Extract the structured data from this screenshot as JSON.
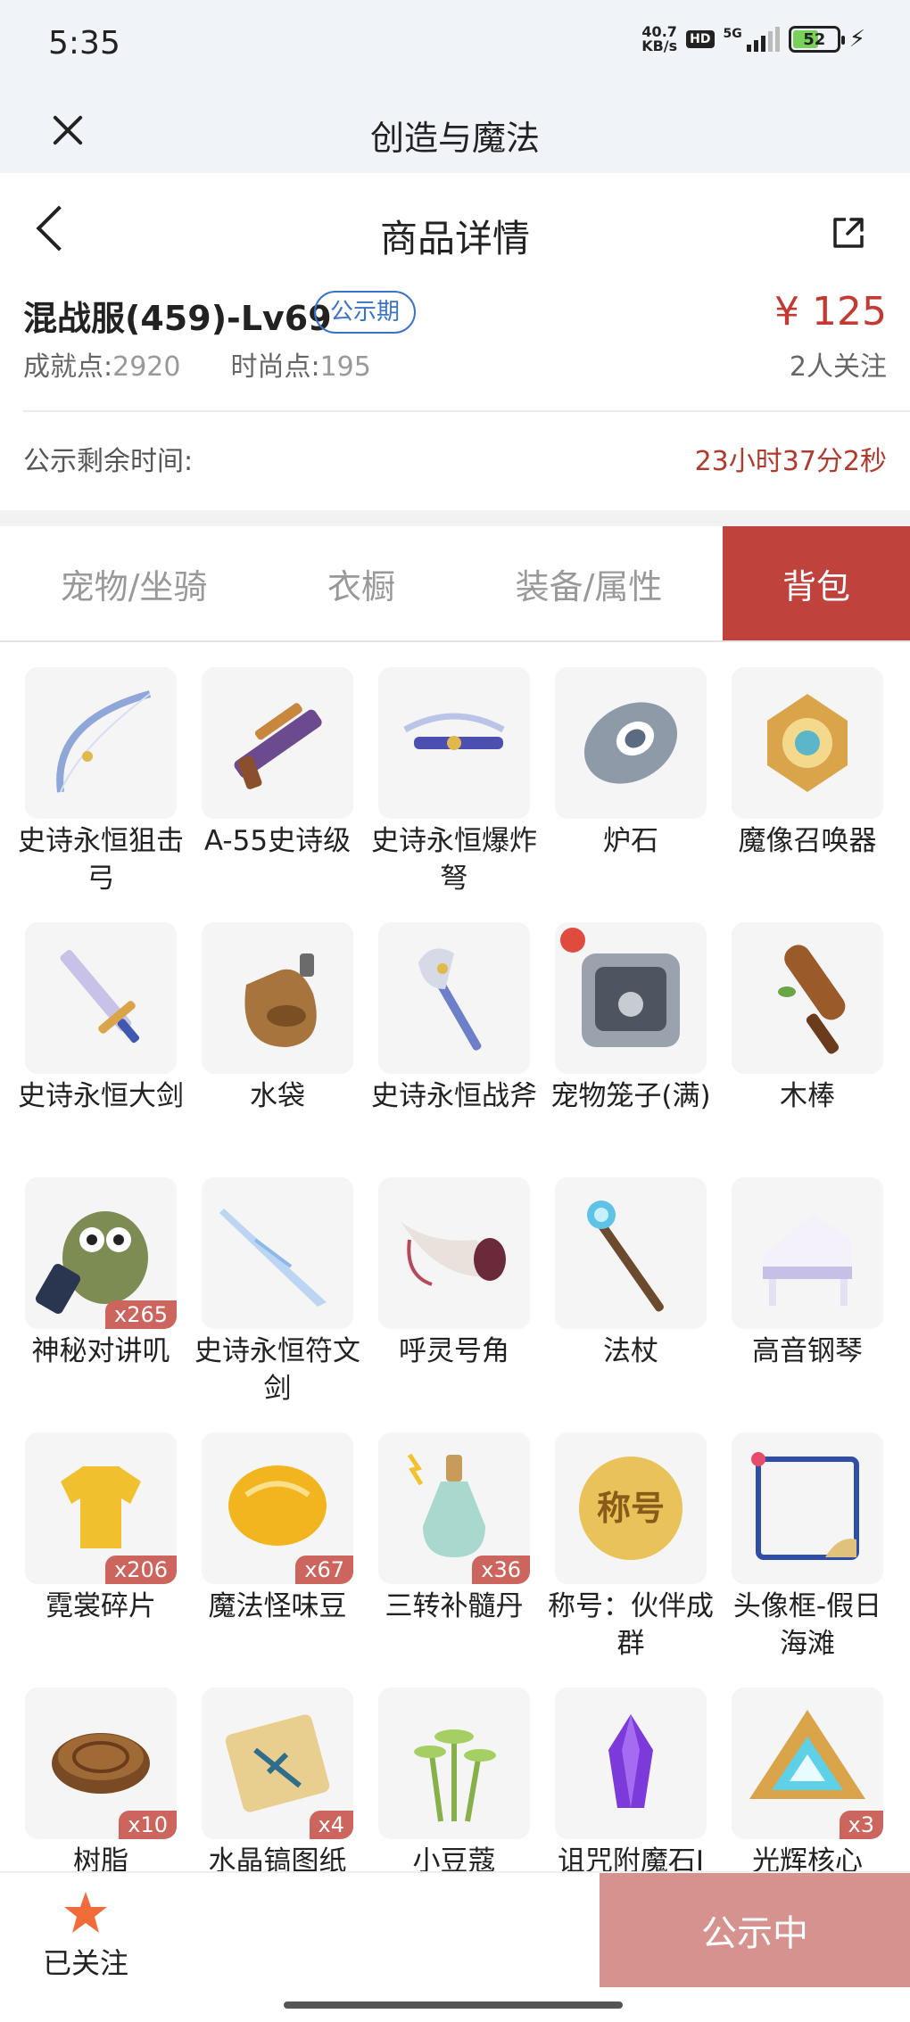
{
  "status_bar": {
    "time": "5:35",
    "speed_value": "40.7",
    "speed_unit": "KB/s",
    "hd": "HD",
    "network": "5G",
    "battery": "52"
  },
  "app": {
    "title": "创造与魔法"
  },
  "header": {
    "title": "商品详情"
  },
  "product": {
    "name": "混战服(459)-Lv69",
    "status": "公示期",
    "price": "¥ 125",
    "achievement_label": "成就点:",
    "achievement_value": "2920",
    "fashion_label": "时尚点:",
    "fashion_value": "195",
    "followers": "2人关注"
  },
  "countdown": {
    "label": "公示剩余时间:",
    "value": "23小时37分2秒"
  },
  "tabs": [
    {
      "label": "宠物/坐骑"
    },
    {
      "label": "衣橱"
    },
    {
      "label": "装备/属性"
    },
    {
      "label": "背包",
      "active": true
    }
  ],
  "items": [
    {
      "name": "史诗永恒狙击弓",
      "icon": "bow-icon"
    },
    {
      "name": "A-55史诗级",
      "icon": "rifle-icon"
    },
    {
      "name": "史诗永恒爆炸弩",
      "icon": "crossbow-icon"
    },
    {
      "name": "炉石",
      "icon": "hearthstone-icon"
    },
    {
      "name": "魔像召唤器",
      "icon": "golem-summoner-icon"
    },
    {
      "name": "史诗永恒大剑",
      "icon": "greatsword-icon"
    },
    {
      "name": "水袋",
      "icon": "water-bag-icon"
    },
    {
      "name": "史诗永恒战斧",
      "icon": "battle-axe-icon"
    },
    {
      "name": "宠物笼子(满)",
      "icon": "pet-cage-icon"
    },
    {
      "name": "木棒",
      "icon": "wooden-club-icon"
    },
    {
      "name": "神秘对讲叽",
      "icon": "walkie-talkie-bird-icon",
      "qty": "x265"
    },
    {
      "name": "史诗永恒符文剑",
      "icon": "rune-sword-icon"
    },
    {
      "name": "呼灵号角",
      "icon": "horn-icon"
    },
    {
      "name": "法杖",
      "icon": "staff-icon"
    },
    {
      "name": "高音钢琴",
      "icon": "piano-icon"
    },
    {
      "name": "霓裳碎片",
      "icon": "shirt-fragment-icon",
      "qty": "x206"
    },
    {
      "name": "魔法怪味豆",
      "icon": "magic-bean-icon",
      "qty": "x67"
    },
    {
      "name": "三转补髓丹",
      "icon": "potion-bottle-icon",
      "qty": "x36"
    },
    {
      "name": "称号：伙伴成群",
      "icon": "title-badge-icon",
      "badge_text": "称号"
    },
    {
      "name": "头像框-假日海滩",
      "icon": "avatar-frame-icon"
    },
    {
      "name": "树脂",
      "icon": "resin-icon",
      "qty": "x10"
    },
    {
      "name": "水晶镐图纸",
      "icon": "blueprint-scroll-icon",
      "qty": "x4"
    },
    {
      "name": "小豆蔻",
      "icon": "cardamom-plant-icon"
    },
    {
      "name": "诅咒附魔石I",
      "icon": "curse-crystal-icon"
    },
    {
      "name": "光辉核心",
      "icon": "radiant-core-icon",
      "qty": "x3"
    }
  ],
  "bottom": {
    "follow_label": "已关注",
    "status_button": "公示中"
  },
  "colors": {
    "accent_red": "#c0423d",
    "price_red": "#c33a32",
    "pill_blue": "#3a74c8",
    "disabled_button": "#d6928e",
    "follow_star": "#f26b3a"
  }
}
